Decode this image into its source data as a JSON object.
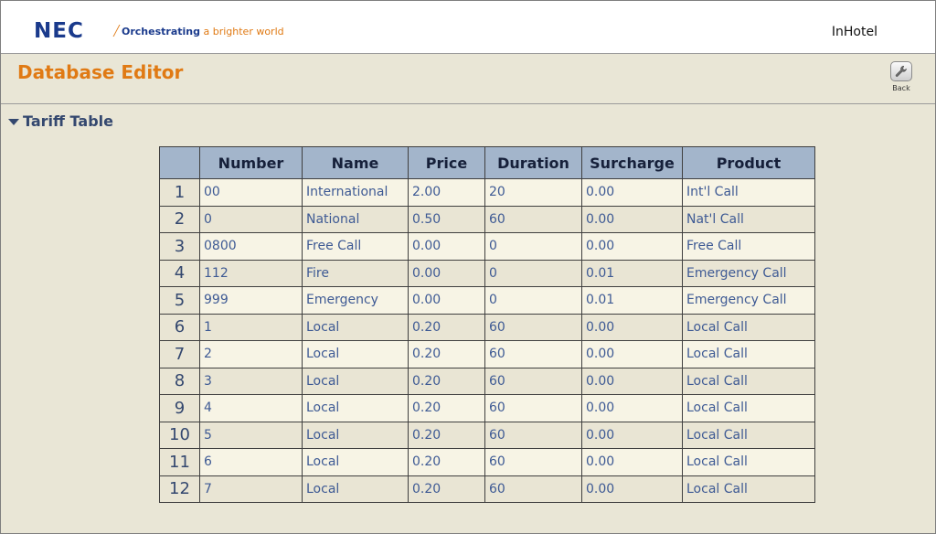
{
  "header": {
    "logo": "NEC",
    "slogan_a": "Orchestrating",
    "slogan_b": " a brighter world",
    "app_name": "InHotel"
  },
  "page": {
    "title": "Database Editor",
    "back_label": "Back"
  },
  "section": {
    "title": "Tariff Table"
  },
  "table": {
    "columns": [
      "",
      "Number",
      "Name",
      "Price",
      "Duration",
      "Surcharge",
      "Product"
    ],
    "rows": [
      [
        "1",
        "00",
        "International",
        "2.00",
        "20",
        "0.00",
        "Int'l Call"
      ],
      [
        "2",
        "0",
        "National",
        "0.50",
        "60",
        "0.00",
        "Nat'l Call"
      ],
      [
        "3",
        "0800",
        "Free Call",
        "0.00",
        "0",
        "0.00",
        "Free Call"
      ],
      [
        "4",
        "112",
        "Fire",
        "0.00",
        "0",
        "0.01",
        "Emergency Call"
      ],
      [
        "5",
        "999",
        "Emergency",
        "0.00",
        "0",
        "0.01",
        "Emergency Call"
      ],
      [
        "6",
        "1",
        "Local",
        "0.20",
        "60",
        "0.00",
        "Local Call"
      ],
      [
        "7",
        "2",
        "Local",
        "0.20",
        "60",
        "0.00",
        "Local Call"
      ],
      [
        "8",
        "3",
        "Local",
        "0.20",
        "60",
        "0.00",
        "Local Call"
      ],
      [
        "9",
        "4",
        "Local",
        "0.20",
        "60",
        "0.00",
        "Local Call"
      ],
      [
        "10",
        "5",
        "Local",
        "0.20",
        "60",
        "0.00",
        "Local Call"
      ],
      [
        "11",
        "6",
        "Local",
        "0.20",
        "60",
        "0.00",
        "Local Call"
      ],
      [
        "12",
        "7",
        "Local",
        "0.20",
        "60",
        "0.00",
        "Local Call"
      ]
    ]
  },
  "colors": {
    "brand_blue": "#1a3a8c",
    "accent_orange": "#e07a14",
    "header_blue": "#a3b5cb",
    "text_blue": "#3e5a94",
    "background": "#e9e6d6"
  },
  "icons": {
    "back": "wrench-icon",
    "section_toggle": "triangle-down-icon"
  }
}
